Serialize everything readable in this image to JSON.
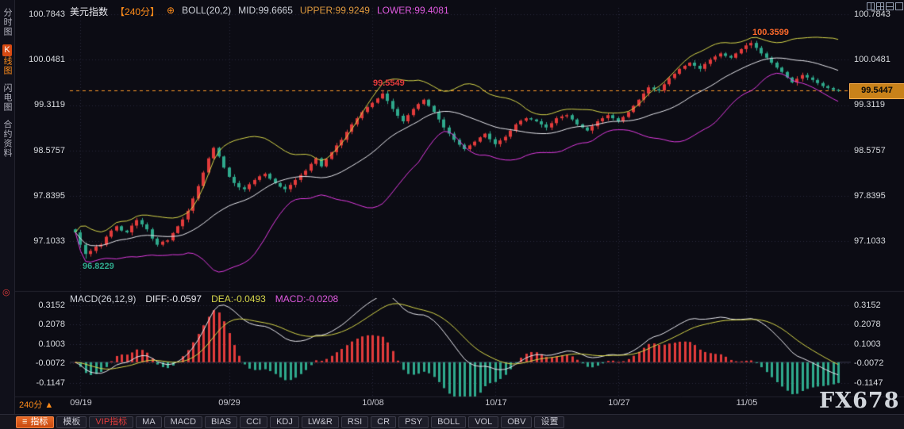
{
  "header": {
    "symbol": "美元指数",
    "period": "【240分】",
    "plus_icon": "⊕",
    "boll": "BOLL(20,2)",
    "mid": "MID:99.6665",
    "upper": "UPPER:99.9249",
    "lower": "LOWER:99.4081"
  },
  "macd_header": {
    "name": "MACD(26,12,9)",
    "diff": "DIFF:-0.0597",
    "dea": "DEA:-0.0493",
    "macd": "MACD:-0.0208"
  },
  "sidebar": {
    "time_chart": "分时图",
    "kline_badge": "K",
    "kline_rest": "线图",
    "flash_chart": "闪电图",
    "contract_info": "合约资料",
    "target_icon": "◎"
  },
  "axes": {
    "price": [
      "100.7843",
      "100.0481",
      "99.3119",
      "98.5757",
      "97.8395",
      "97.1033"
    ],
    "macd": [
      "0.3152",
      "0.2078",
      "0.1003",
      "-0.0072",
      "-0.1147"
    ],
    "dates": [
      "09/19",
      "09/29",
      "10/08",
      "10/17",
      "10/27",
      "11/05"
    ]
  },
  "annotations": {
    "swing_high": "100.3599",
    "mid_high": "99.5549",
    "swing_low": "96.8229",
    "last_price": "99.5447"
  },
  "footer": {
    "period": "240分",
    "arrow": "▲",
    "menu_icon": "≡",
    "indicators_button": "指标",
    "tabs": [
      "模板",
      "VIP指标",
      "MA",
      "MACD",
      "BIAS",
      "CCI",
      "KDJ",
      "LW&R",
      "RSI",
      "CR",
      "PSY",
      "BOLL",
      "VOL",
      "OBV",
      "设置"
    ]
  },
  "watermark": "FX678",
  "colors": {
    "background": "#0c0c14",
    "up": "#e23b3b",
    "down": "#2fa98c",
    "boll_upper": "#d6d64a",
    "boll_mid": "#e8e8ee",
    "boll_lower": "#e03be0",
    "diff": "#e8e8ee",
    "dea": "#d6d64a",
    "current_line": "#ff9b2a",
    "accent": "#ff8c1a"
  },
  "chart_data": {
    "type": "candlestick",
    "title": "美元指数 240分 K线 BOLL(20,2) + MACD(26,12,9)",
    "ylim": [
      96.45,
      100.89
    ],
    "price_ticks": [
      100.7843,
      100.0481,
      99.3119,
      98.5757,
      97.8395,
      97.1033
    ],
    "x_ticks": [
      {
        "label": "09/19",
        "index": 1
      },
      {
        "label": "09/29",
        "index": 30
      },
      {
        "label": "10/08",
        "index": 58
      },
      {
        "label": "10/17",
        "index": 82
      },
      {
        "label": "10/27",
        "index": 106
      },
      {
        "label": "11/05",
        "index": 131
      }
    ],
    "boll": {
      "period": 20,
      "width": 2,
      "mid": 99.6665,
      "upper": 99.9249,
      "lower": 99.4081
    },
    "macd": {
      "fast": 12,
      "slow": 26,
      "signal": 9,
      "diff": -0.0597,
      "dea": -0.0493,
      "hist": -0.0208,
      "ticks": [
        0.3152,
        0.2078,
        0.1003,
        -0.0072,
        -0.1147
      ]
    },
    "last_price": 99.5447,
    "swing_high": 100.3599,
    "interim_high": 99.5549,
    "swing_low": 96.8229,
    "closes": [
      97.25,
      97.05,
      96.9,
      96.95,
      97.02,
      97.05,
      97.18,
      97.28,
      97.35,
      97.28,
      97.25,
      97.36,
      97.45,
      97.38,
      97.3,
      97.15,
      97.05,
      97.1,
      97.12,
      97.24,
      97.35,
      97.46,
      97.6,
      97.8,
      98.0,
      98.22,
      98.45,
      98.62,
      98.48,
      98.3,
      98.15,
      98.05,
      97.98,
      97.95,
      98.03,
      98.1,
      98.16,
      98.2,
      98.12,
      98.05,
      97.99,
      97.95,
      98.02,
      98.1,
      98.18,
      98.25,
      98.36,
      98.45,
      98.32,
      98.44,
      98.55,
      98.66,
      98.75,
      98.88,
      99.0,
      99.1,
      99.2,
      99.28,
      99.35,
      99.42,
      99.5,
      99.38,
      99.25,
      99.14,
      99.05,
      99.15,
      99.25,
      99.33,
      99.4,
      99.3,
      99.2,
      99.08,
      98.95,
      98.85,
      98.75,
      98.67,
      98.6,
      98.66,
      98.72,
      98.79,
      98.85,
      98.76,
      98.68,
      98.74,
      98.8,
      98.9,
      99.0,
      99.06,
      99.1,
      99.08,
      99.05,
      99.0,
      98.95,
      99.02,
      99.1,
      99.13,
      99.15,
      99.08,
      99.0,
      98.95,
      98.9,
      98.97,
      99.05,
      99.1,
      99.15,
      99.1,
      99.05,
      99.12,
      99.2,
      99.3,
      99.4,
      99.5,
      99.6,
      99.57,
      99.55,
      99.65,
      99.75,
      99.82,
      99.9,
      99.95,
      100.0,
      99.95,
      99.9,
      99.98,
      100.05,
      100.1,
      100.15,
      100.11,
      100.08,
      100.15,
      100.22,
      100.28,
      100.32,
      100.24,
      100.15,
      100.08,
      100.0,
      99.92,
      99.85,
      99.76,
      99.68,
      99.74,
      99.8,
      99.76,
      99.72,
      99.67,
      99.62,
      99.59,
      99.56,
      99.5447
    ]
  }
}
